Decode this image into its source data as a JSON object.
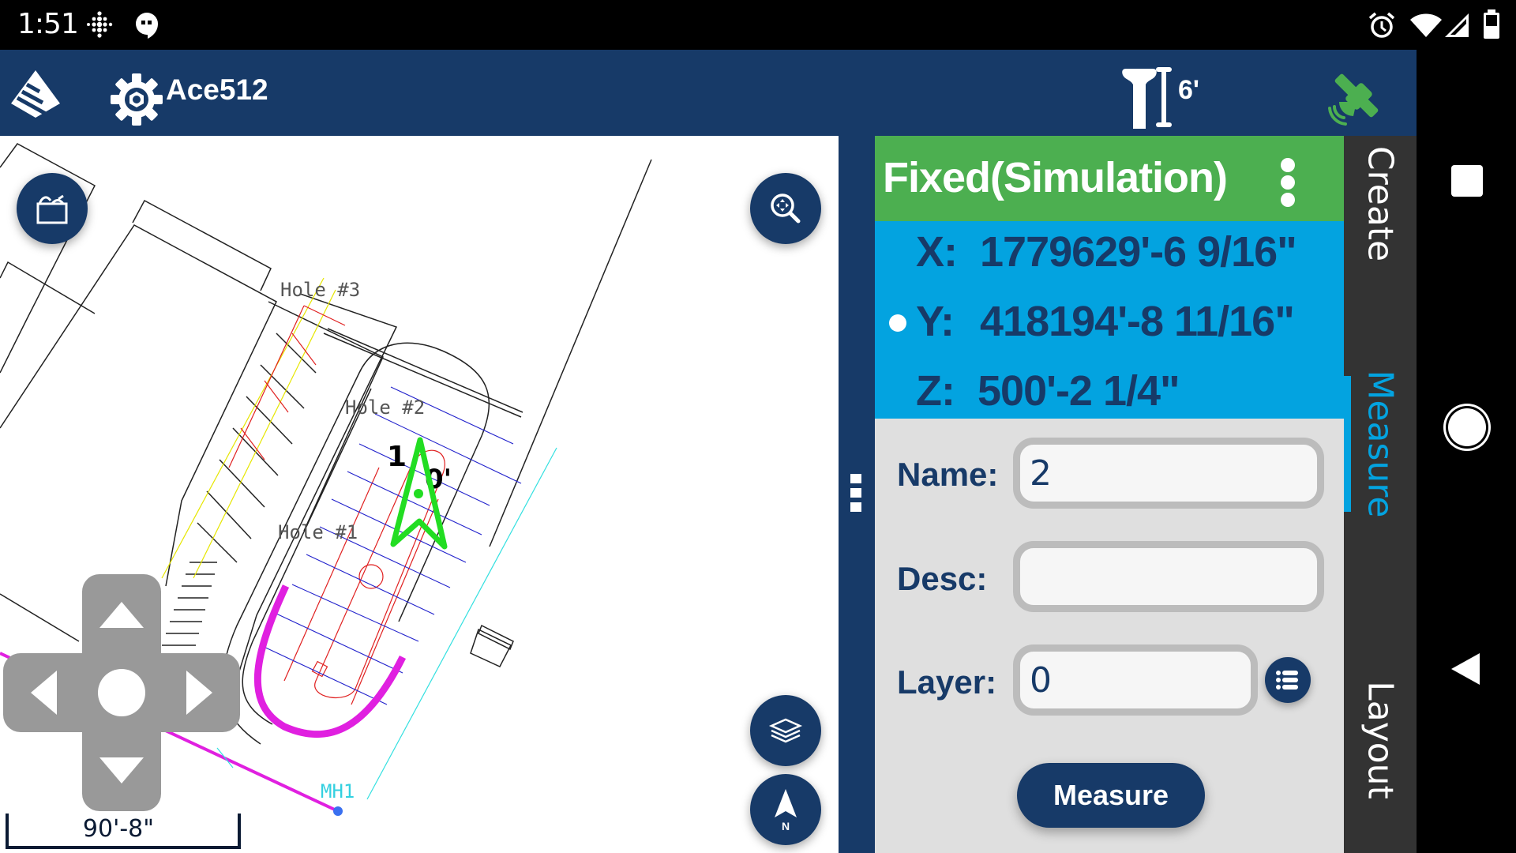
{
  "status_bar": {
    "time": "1:51",
    "left_icons": [
      "fitbit-icon",
      "hangouts-icon"
    ],
    "right_icons": [
      "alarm-icon",
      "wifi-icon",
      "signal-icon",
      "battery-icon"
    ]
  },
  "app_bar": {
    "logo_icon": "pyramid-logo-icon",
    "settings_icon": "gear-icon",
    "title": "Ace512",
    "pole_icon": "rover-pole-icon",
    "pole_height": "6'",
    "satellite_icon": "satellite-icon",
    "satellite_color": "#4caf50"
  },
  "map": {
    "toolbox_icon": "toolbox-icon",
    "zoom_extents_icon": "zoom-extents-icon",
    "layers_icon": "layers-icon",
    "north_icon": "north-arrow-icon",
    "north_label": "N",
    "labels": {
      "hole3": "Hole  #3",
      "hole2": "Hole  #2",
      "hole1": "Hole  #1",
      "mh1": "MH1",
      "dim": "1",
      "dim2": "0'"
    },
    "scale_label": "90'-8\"",
    "dpad": [
      "up",
      "left",
      "center",
      "right",
      "down"
    ]
  },
  "panel": {
    "fix_status": "Fixed(Simulation)",
    "fix_color": "#4caf50",
    "coords": [
      {
        "axis": "X:",
        "value": "1779629'-6 9/16\"",
        "selected": false
      },
      {
        "axis": "Y:",
        "value": "418194'-8 11/16\"",
        "selected": true
      },
      {
        "axis": "Z:",
        "value": "500'-2 1/4\"",
        "selected": false
      }
    ],
    "form": {
      "name_label": "Name:",
      "name_value": "2",
      "desc_label": "Desc:",
      "desc_value": "",
      "layer_label": "Layer:",
      "layer_value": "0",
      "layer_list_icon": "list-icon"
    },
    "measure_button": "Measure"
  },
  "tabs": [
    {
      "label": "Create",
      "active": false
    },
    {
      "label": "Measure",
      "active": true
    },
    {
      "label": "Layout",
      "active": false
    }
  ],
  "colors": {
    "primary": "#173a68",
    "accent": "#03a3e0",
    "fix_green": "#4caf50"
  },
  "nav_bar": [
    "recents-button",
    "home-button",
    "back-button"
  ]
}
